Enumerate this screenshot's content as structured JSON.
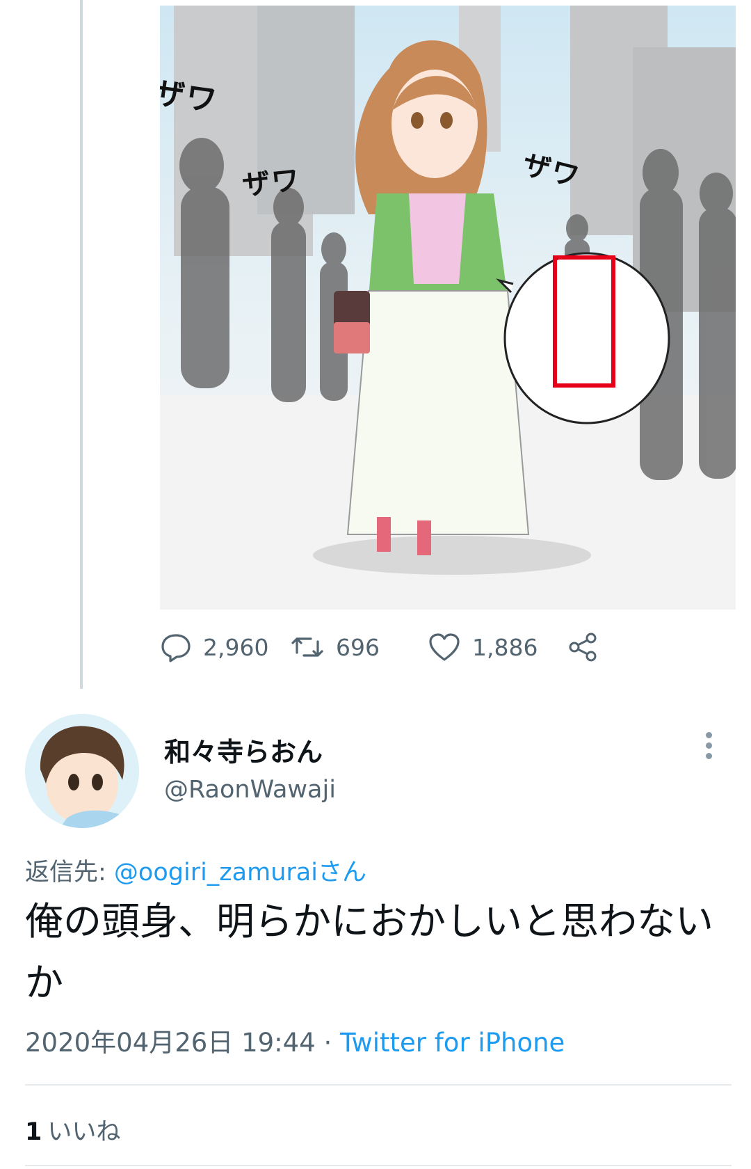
{
  "media": {
    "sfx_1": "ザワ",
    "sfx_2": "ザワ",
    "sfx_3": "ザワ"
  },
  "actions": {
    "replies": "2,960",
    "retweets": "696",
    "likes": "1,886",
    "icons": [
      "reply-icon",
      "retweet-icon",
      "like-icon",
      "share-icon"
    ]
  },
  "tweet": {
    "display_name": "和々寺らおん",
    "handle": "@RaonWawaji",
    "reply_prefix": "返信先: ",
    "reply_target": "@oogiri_zamuraiさん",
    "text": "俺の頭身、明らかにおかしいと思わないか",
    "timestamp": "2020年04月26日 19:44",
    "separator": " · ",
    "source": "Twitter for iPhone",
    "like_count": "1",
    "like_label": "いいね"
  },
  "colors": {
    "link": "#1d9bf0",
    "secondary_text": "#536471",
    "highlight_box": "#e6001a"
  }
}
